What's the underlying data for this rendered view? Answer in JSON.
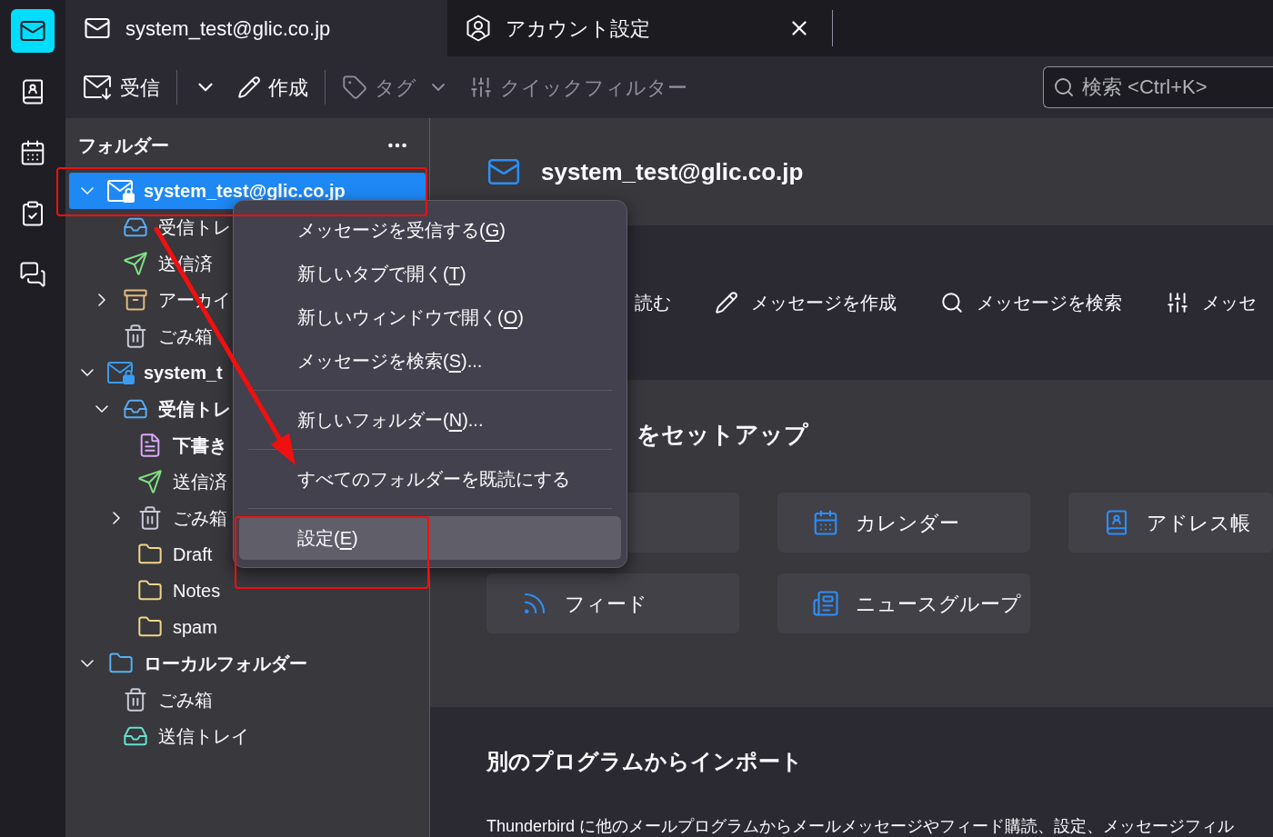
{
  "spaces_bar": {
    "items": [
      {
        "kind": "mail",
        "selected": true
      },
      {
        "kind": "address_book",
        "selected": false
      },
      {
        "kind": "calendar",
        "selected": false
      },
      {
        "kind": "tasks",
        "selected": false
      },
      {
        "kind": "chat",
        "selected": false
      }
    ]
  },
  "tabs": [
    {
      "kind": "mail",
      "label": "system_test@glic.co.jp",
      "selected": true,
      "closable": false
    },
    {
      "kind": "account_settings",
      "label": "アカウント設定",
      "selected": false,
      "closable": true
    }
  ],
  "toolbar": {
    "buttons": [
      {
        "kind": "get_messages",
        "label": "受信",
        "disabled": false
      },
      {
        "kind": "separator"
      },
      {
        "kind": "dropdown",
        "disabled": false
      },
      {
        "kind": "write",
        "label": "作成",
        "disabled": false
      },
      {
        "kind": "separator"
      },
      {
        "kind": "tag",
        "label": "タグ",
        "disabled": true
      },
      {
        "kind": "quick_filter",
        "label": "クイックフィルター",
        "disabled": true
      }
    ],
    "search": {
      "placeholder": "検索 <Ctrl+K>"
    }
  },
  "folder_pane": {
    "title": "フォルダー",
    "tree": [
      {
        "kind": "account",
        "label": "system_test@glic.co.jp",
        "bold": true,
        "selected": true,
        "expanded": true,
        "children": [
          {
            "kind": "inbox",
            "label": "受信トレ",
            "bold": false,
            "selected": false
          },
          {
            "kind": "sent",
            "label": "送信済",
            "bold": false,
            "selected": false
          },
          {
            "kind": "archive",
            "label": "アーカイ",
            "bold": false,
            "selected": false,
            "expanded": false
          },
          {
            "kind": "trash",
            "label": "ごみ箱",
            "bold": false,
            "selected": false
          }
        ]
      },
      {
        "kind": "account",
        "label": "system_t",
        "bold": true,
        "selected": false,
        "expanded": true,
        "children": [
          {
            "kind": "inbox",
            "label": "受信トレ",
            "bold": true,
            "selected": false,
            "expanded": true,
            "children": [
              {
                "kind": "drafts",
                "label": "下書き",
                "bold": true,
                "selected": false
              },
              {
                "kind": "sent",
                "label": "送信済",
                "bold": false,
                "selected": false
              },
              {
                "kind": "trash",
                "label": "ごみ箱",
                "bold": false,
                "selected": false,
                "expanded": false
              },
              {
                "kind": "folder",
                "label": "Draft",
                "bold": false,
                "selected": false
              },
              {
                "kind": "folder",
                "label": "Notes",
                "bold": false,
                "selected": false
              },
              {
                "kind": "folder",
                "label": "spam",
                "bold": false,
                "selected": false
              }
            ]
          }
        ]
      },
      {
        "kind": "local",
        "label": "ローカルフォルダー",
        "bold": true,
        "selected": false,
        "expanded": true,
        "children": [
          {
            "kind": "trash",
            "label": "ごみ箱",
            "bold": false,
            "selected": false
          },
          {
            "kind": "outbox",
            "label": "送信トレイ",
            "bold": false,
            "selected": false
          }
        ]
      }
    ]
  },
  "context_menu": {
    "items": [
      {
        "kind": "item",
        "text": "メッセージを受信する(",
        "accesskey": "G",
        "text_end": ")",
        "selected": false
      },
      {
        "kind": "item",
        "text": "新しいタブで開く(",
        "accesskey": "T",
        "text_end": ")",
        "selected": false
      },
      {
        "kind": "item",
        "text": "新しいウィンドウで開く(",
        "accesskey": "O",
        "text_end": ")",
        "selected": false
      },
      {
        "kind": "item",
        "text": "メッセージを検索(",
        "accesskey": "S",
        "text_end": ")...",
        "selected": false
      },
      {
        "kind": "separator"
      },
      {
        "kind": "item",
        "text": "新しいフォルダー(",
        "accesskey": "N",
        "text_end": ")...",
        "selected": false
      },
      {
        "kind": "separator"
      },
      {
        "kind": "item",
        "text": "すべてのフォルダーを既読にする",
        "selected": false
      },
      {
        "kind": "separator"
      },
      {
        "kind": "item",
        "text": "設定(",
        "accesskey": "E",
        "text_end": ")",
        "selected": true
      }
    ]
  },
  "main": {
    "account": "system_test@glic.co.jp",
    "actions": [
      {
        "kind": "read",
        "label": "読む"
      },
      {
        "kind": "write",
        "label": "メッセージを作成"
      },
      {
        "kind": "search",
        "label": "メッセージを検索"
      },
      {
        "kind": "filters",
        "label": "メッセ"
      }
    ],
    "setup": {
      "title": "をセットアップ",
      "cards": [
        {
          "kind": "covered"
        },
        {
          "kind": "calendar",
          "label": "カレンダー"
        },
        {
          "kind": "address_book",
          "label": "アドレス帳"
        },
        {
          "kind": "feed",
          "label": "フィード"
        },
        {
          "kind": "newsgroup",
          "label": "ニュースグループ"
        }
      ]
    },
    "import": {
      "title": "別のプログラムからインポート",
      "text": "Thunderbird に他のメールプログラムからメールメッセージやフィード購読、設定、メッセージフィル"
    }
  },
  "annotations": [
    {
      "kind": "frame"
    },
    {
      "kind": "arrow"
    },
    {
      "kind": "frame"
    }
  ]
}
